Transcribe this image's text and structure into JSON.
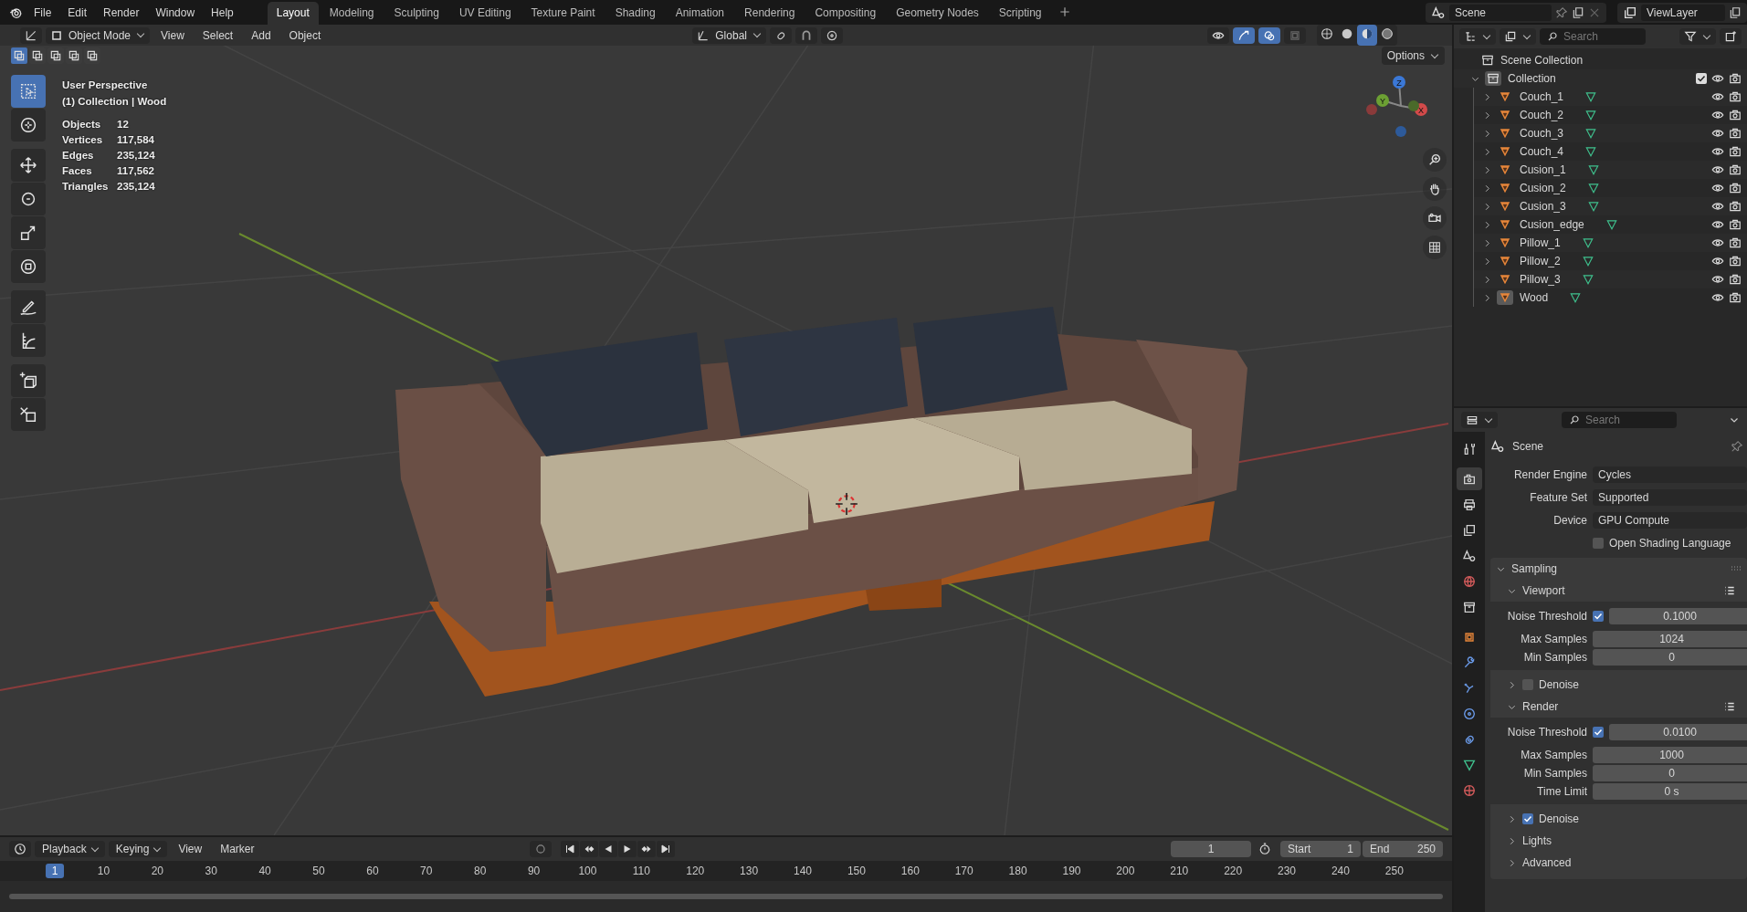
{
  "menu": [
    "File",
    "Edit",
    "Render",
    "Window",
    "Help"
  ],
  "workspaces": [
    {
      "label": "Layout",
      "selected": true
    },
    {
      "label": "Modeling",
      "selected": false
    },
    {
      "label": "Sculpting",
      "selected": false
    },
    {
      "label": "UV Editing",
      "selected": false
    },
    {
      "label": "Texture Paint",
      "selected": false
    },
    {
      "label": "Shading",
      "selected": false
    },
    {
      "label": "Animation",
      "selected": false
    },
    {
      "label": "Rendering",
      "selected": false
    },
    {
      "label": "Compositing",
      "selected": false
    },
    {
      "label": "Geometry Nodes",
      "selected": false
    },
    {
      "label": "Scripting",
      "selected": false
    }
  ],
  "scene": {
    "label": "Scene"
  },
  "view_layer": {
    "label": "ViewLayer"
  },
  "viewport": {
    "mode": "Object Mode",
    "menus": [
      "View",
      "Select",
      "Add",
      "Object"
    ],
    "orientation": "Global",
    "options": "Options",
    "select_modes": [
      {
        "selected": true
      },
      {
        "selected": false
      },
      {
        "selected": false
      },
      {
        "selected": false
      },
      {
        "selected": false
      }
    ],
    "shading": [
      {
        "kind": "wireframe",
        "selected": false
      },
      {
        "kind": "solid",
        "selected": false
      },
      {
        "kind": "material",
        "selected": true
      },
      {
        "kind": "rendered",
        "selected": false
      }
    ],
    "overlay": {
      "view_name": "User Perspective",
      "context": "(1) Collection | Wood",
      "stats": [
        {
          "label": "Objects",
          "value": "12"
        },
        {
          "label": "Vertices",
          "value": "117,584"
        },
        {
          "label": "Edges",
          "value": "235,124"
        },
        {
          "label": "Faces",
          "value": "117,562"
        },
        {
          "label": "Triangles",
          "value": "235,124"
        }
      ]
    },
    "tools": [
      {
        "kind": "select",
        "selected": true
      },
      {
        "kind": "cursor",
        "selected": false
      },
      {
        "kind": "move",
        "selected": false
      },
      {
        "kind": "rotate",
        "selected": false
      },
      {
        "kind": "scale",
        "selected": false
      },
      {
        "kind": "transform",
        "selected": false
      },
      {
        "kind": "annotate",
        "selected": false
      },
      {
        "kind": "measure",
        "selected": false
      },
      {
        "kind": "add_cube",
        "selected": false
      },
      {
        "kind": "shear",
        "selected": false
      }
    ],
    "gizmo": {
      "axes": [
        "Z",
        "Y",
        "X"
      ]
    }
  },
  "outliner": {
    "search": {
      "placeholder": "Search"
    },
    "root": "Scene Collection",
    "collection": {
      "label": "Collection",
      "expanded": true,
      "checked": true,
      "children": [
        {
          "label": "Couch_1",
          "expanded": false,
          "selected": false
        },
        {
          "label": "Couch_2",
          "expanded": false,
          "selected": false
        },
        {
          "label": "Couch_3",
          "expanded": false,
          "selected": false
        },
        {
          "label": "Couch_4",
          "expanded": false,
          "selected": false
        },
        {
          "label": "Cusion_1",
          "expanded": false,
          "selected": false
        },
        {
          "label": "Cusion_2",
          "expanded": false,
          "selected": false
        },
        {
          "label": "Cusion_3",
          "expanded": false,
          "selected": false
        },
        {
          "label": "Cusion_edge",
          "expanded": false,
          "selected": false
        },
        {
          "label": "Pillow_1",
          "expanded": false,
          "selected": false
        },
        {
          "label": "Pillow_2",
          "expanded": false,
          "selected": false
        },
        {
          "label": "Pillow_3",
          "expanded": false,
          "selected": false
        },
        {
          "label": "Wood",
          "expanded": false,
          "selected": true
        }
      ]
    }
  },
  "properties": {
    "search": {
      "placeholder": "Search"
    },
    "tabs": [
      {
        "kind": "tool",
        "selected": false
      },
      {
        "kind": "render",
        "selected": true
      },
      {
        "kind": "output",
        "selected": false
      },
      {
        "kind": "view_layer",
        "selected": false
      },
      {
        "kind": "scene",
        "selected": false
      },
      {
        "kind": "world",
        "selected": false
      },
      {
        "kind": "collection",
        "selected": false
      },
      {
        "kind": "object",
        "selected": false
      },
      {
        "kind": "modifier",
        "selected": false
      },
      {
        "kind": "particles",
        "selected": false
      },
      {
        "kind": "physics",
        "selected": false
      },
      {
        "kind": "constraints",
        "selected": false
      },
      {
        "kind": "data",
        "selected": false
      },
      {
        "kind": "material",
        "selected": false
      }
    ],
    "context": "Scene",
    "fields": [
      {
        "kind": "dropdown",
        "label": "Render Engine",
        "value": "Cycles"
      },
      {
        "kind": "dropdown",
        "label": "Feature Set",
        "value": "Supported"
      },
      {
        "kind": "dropdown",
        "label": "Device",
        "value": "GPU Compute"
      },
      {
        "kind": "checkbox",
        "label": "Open Shading Language",
        "checked": false
      }
    ],
    "panels": [
      {
        "label": "Sampling",
        "expanded": true,
        "subpanels": [
          {
            "label": "Viewport",
            "expanded": true,
            "rows": [
              {
                "kind": "toggle_number",
                "label": "Noise Threshold",
                "checked": true,
                "value": "0.1000"
              },
              {
                "kind": "number",
                "label": "Max Samples",
                "value": "1024"
              },
              {
                "kind": "number",
                "label": "Min Samples",
                "value": "0"
              }
            ]
          },
          {
            "label": "Denoise",
            "expanded": false,
            "checked": false
          },
          {
            "label": "Render",
            "expanded": true,
            "rows": [
              {
                "kind": "toggle_number",
                "label": "Noise Threshold",
                "checked": true,
                "value": "0.0100"
              },
              {
                "kind": "number",
                "label": "Max Samples",
                "value": "1000"
              },
              {
                "kind": "number",
                "label": "Min Samples",
                "value": "0"
              },
              {
                "kind": "number",
                "label": "Time Limit",
                "value": "0 s"
              }
            ]
          },
          {
            "label": "Denoise",
            "expanded": false,
            "checked": true
          },
          {
            "label": "Lights",
            "expanded": false
          },
          {
            "label": "Advanced",
            "expanded": false
          }
        ]
      }
    ]
  },
  "timeline": {
    "menus": [
      {
        "label": "Playback",
        "dropdown": true
      },
      {
        "label": "Keying",
        "dropdown": true
      },
      {
        "label": "View",
        "dropdown": false
      },
      {
        "label": "Marker",
        "dropdown": false
      }
    ],
    "current_frame": "1",
    "start_label": "Start",
    "start": "1",
    "end_label": "End",
    "end": "250",
    "ruler": {
      "current": "1",
      "labels": [
        "10",
        "20",
        "30",
        "40",
        "50",
        "60",
        "70",
        "80",
        "90",
        "100",
        "110",
        "120",
        "130",
        "140",
        "150",
        "160",
        "170",
        "180",
        "190",
        "200",
        "210",
        "220",
        "230",
        "240",
        "250"
      ]
    }
  }
}
